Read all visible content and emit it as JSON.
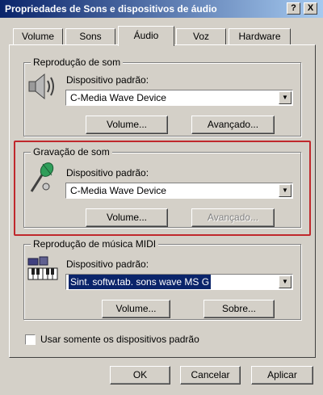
{
  "window": {
    "title": "Propriedades de Sons e dispositivos de áudio",
    "help_button": "?",
    "close_button": "X"
  },
  "tabs": [
    {
      "label": "Volume",
      "active": false
    },
    {
      "label": "Sons",
      "active": false
    },
    {
      "label": "Áudio",
      "active": true
    },
    {
      "label": "Voz",
      "active": false
    },
    {
      "label": "Hardware",
      "active": false
    }
  ],
  "playback": {
    "legend": "Reprodução de som",
    "device_label": "Dispositivo padrão:",
    "device_value": "C-Media Wave Device",
    "volume_button": "Volume...",
    "advanced_button": "Avançado...",
    "icon": "speaker-icon"
  },
  "recording": {
    "legend": "Gravação de som",
    "device_label": "Dispositivo padrão:",
    "device_value": "C-Media Wave Device",
    "volume_button": "Volume...",
    "advanced_button": "Avançado...",
    "advanced_enabled": false,
    "icon": "microphone-icon"
  },
  "midi": {
    "legend": "Reprodução de música MIDI",
    "device_label": "Dispositivo padrão:",
    "device_value": "Sint. softw.tab. sons wave MS G",
    "volume_button": "Volume...",
    "about_button": "Sobre...",
    "icon": "keyboard-icon"
  },
  "use_default_only": {
    "label": "Usar somente os dispositivos padrão",
    "checked": false
  },
  "footer": {
    "ok": "OK",
    "cancel": "Cancelar",
    "apply": "Aplicar"
  },
  "colors": {
    "titlebar_start": "#0a246a",
    "titlebar_end": "#a6caf0",
    "highlight_border": "#c0282c",
    "selection": "#0a246a"
  }
}
